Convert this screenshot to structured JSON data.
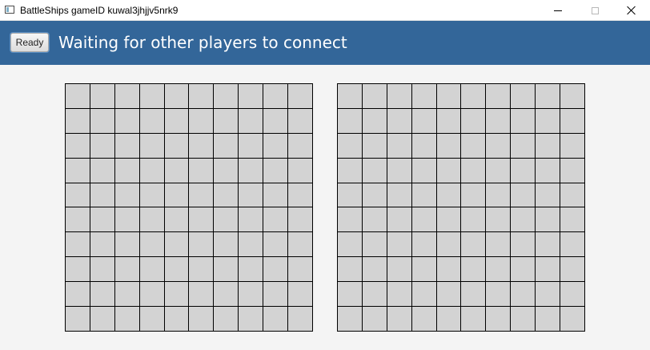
{
  "window": {
    "title": "BattleShips gameID kuwal3jhjjv5nrk9",
    "controls": [
      "minimize-icon",
      "maximize-icon",
      "close-icon"
    ]
  },
  "header": {
    "ready_label": "Ready",
    "status": "Waiting for other players to connect",
    "background_color": "#336699"
  },
  "boards": [
    {
      "name": "player-board",
      "rows": 10,
      "cols": 10,
      "cell_color": "#d3d3d3"
    },
    {
      "name": "opponent-board",
      "rows": 10,
      "cols": 10,
      "cell_color": "#d3d3d3"
    }
  ]
}
